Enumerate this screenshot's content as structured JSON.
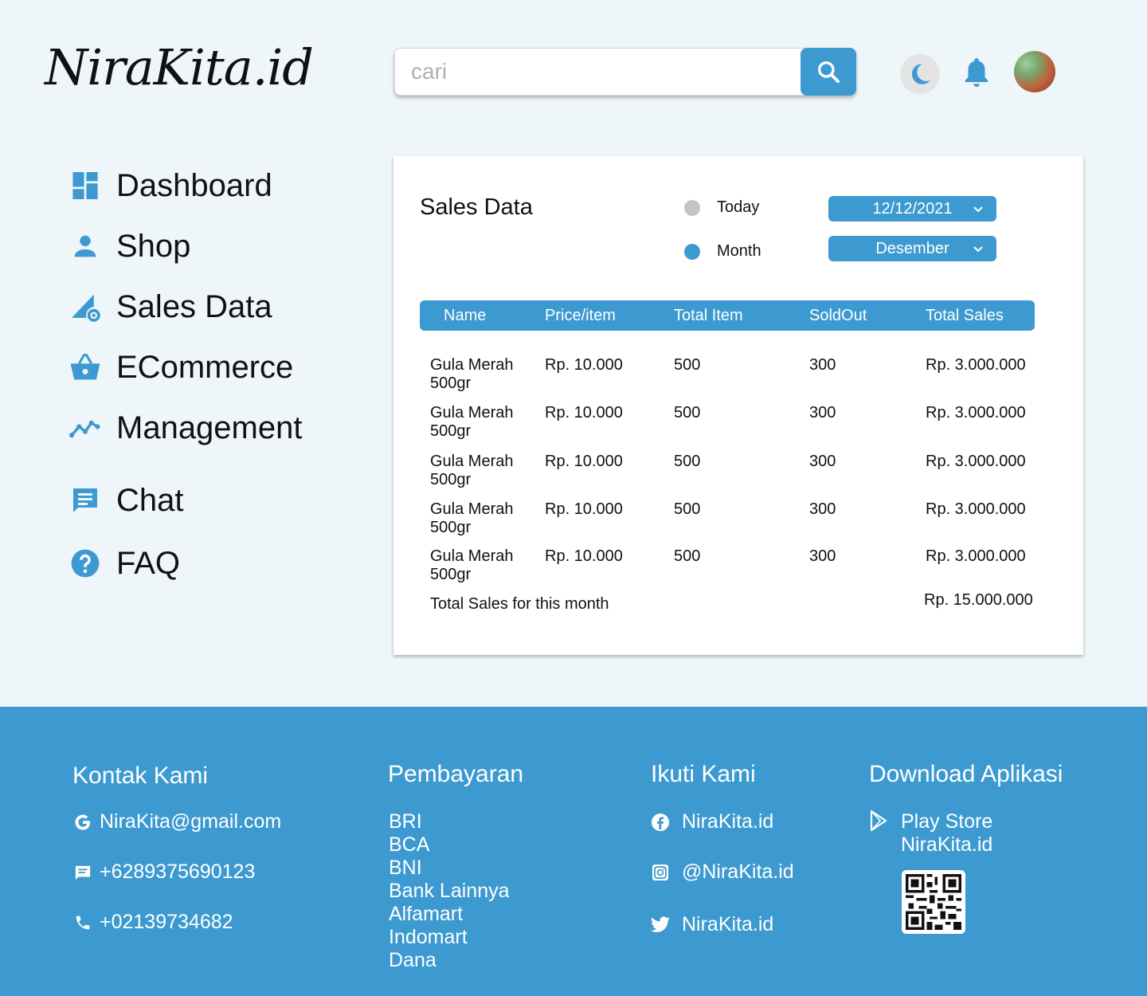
{
  "header": {
    "logo": "NiraKita.id",
    "search": {
      "placeholder": "cari"
    },
    "icons": [
      "search-icon",
      "moon-icon",
      "bell-icon",
      "avatar"
    ]
  },
  "sidebar": {
    "items": [
      {
        "label": "Dashboard",
        "icon": "dashboard-icon"
      },
      {
        "label": "Shop",
        "icon": "person-icon"
      },
      {
        "label": "Sales Data",
        "icon": "chart-settings-icon"
      },
      {
        "label": "ECommerce",
        "icon": "basket-icon"
      },
      {
        "label": "Management",
        "icon": "trend-icon"
      },
      {
        "label": "Chat",
        "icon": "chat-icon"
      },
      {
        "label": "FAQ",
        "icon": "help-icon"
      }
    ]
  },
  "sales": {
    "title": "Sales Data",
    "filters": {
      "today_label": "Today",
      "month_label": "Month",
      "date_value": "12/12/2021",
      "month_value": "Desember",
      "selected": "Month"
    },
    "columns": [
      "Name",
      "Price/item",
      "Total Item",
      "SoldOut",
      "Total Sales"
    ],
    "rows": [
      [
        "Gula Merah 500gr",
        "Rp. 10.000",
        "500",
        "300",
        "Rp. 3.000.000"
      ],
      [
        "Gula Merah 500gr",
        "Rp. 10.000",
        "500",
        "300",
        "Rp. 3.000.000"
      ],
      [
        "Gula Merah 500gr",
        "Rp. 10.000",
        "500",
        "300",
        "Rp. 3.000.000"
      ],
      [
        "Gula Merah 500gr",
        "Rp. 10.000",
        "500",
        "300",
        "Rp. 3.000.000"
      ],
      [
        "Gula Merah 500gr",
        "Rp. 10.000",
        "500",
        "300",
        "Rp. 3.000.000"
      ]
    ],
    "total_label": "Total Sales for this month",
    "total_value": "Rp. 15.000.000"
  },
  "footer": {
    "contact": {
      "heading": "Kontak Kami",
      "email": "NiraKita@gmail.com",
      "sms": "+6289375690123",
      "phone": "+02139734682"
    },
    "payment": {
      "heading": "Pembayaran",
      "items": [
        "BRI",
        "BCA",
        "BNI",
        "Bank Lainnya",
        "Alfamart",
        "Indomart",
        "Dana"
      ]
    },
    "follow": {
      "heading": "Ikuti Kami",
      "facebook": "NiraKita.id",
      "instagram": "@NiraKita.id",
      "twitter": "NiraKita.id"
    },
    "download": {
      "heading": "Download Aplikasi",
      "store": "Play Store",
      "app": "NiraKita.id"
    }
  },
  "colors": {
    "accent": "#3c9ad0",
    "background": "#eef6fa",
    "radio_inactive": "#c4c4c4"
  }
}
